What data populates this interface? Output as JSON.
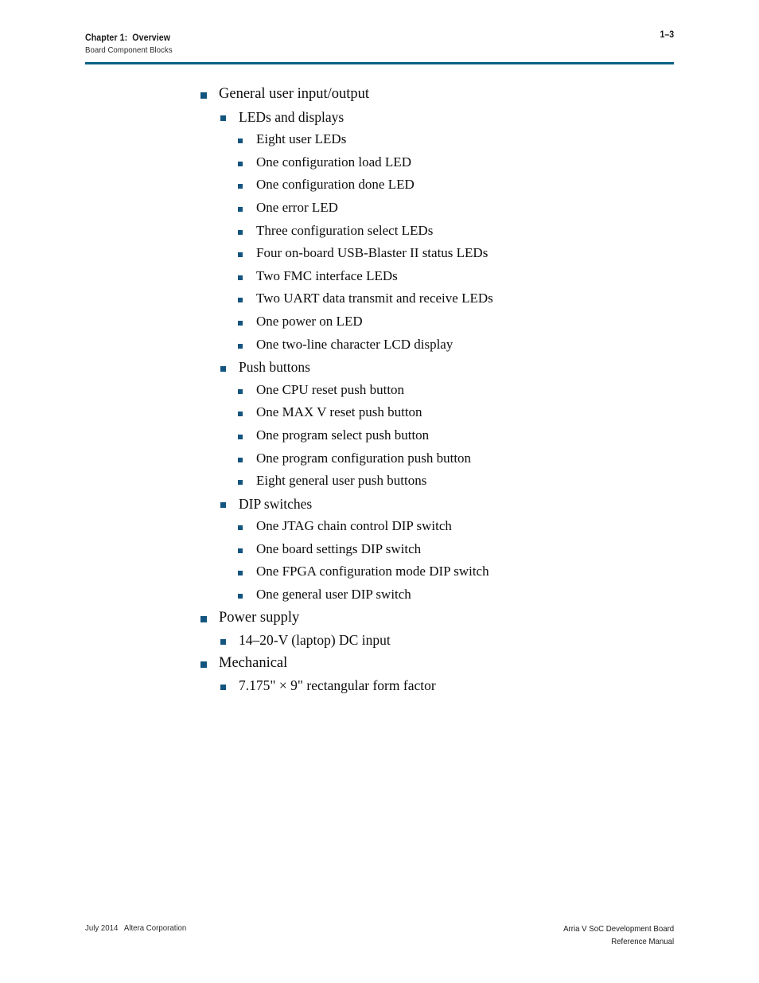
{
  "header": {
    "chapter": "Chapter 1:  Overview",
    "subtitle": "Board Component Blocks",
    "page_number": "1–3",
    "rule_color": "#0a6185"
  },
  "bullet_color": "#13557f",
  "list": [
    {
      "level": 1,
      "text": "General user input/output"
    },
    {
      "level": 2,
      "text": "LEDs and displays"
    },
    {
      "level": 3,
      "text": "Eight user LEDs"
    },
    {
      "level": 3,
      "text": "One configuration load LED"
    },
    {
      "level": 3,
      "text": "One configuration done LED"
    },
    {
      "level": 3,
      "text": "One error LED"
    },
    {
      "level": 3,
      "text": "Three configuration select LEDs"
    },
    {
      "level": 3,
      "text": "Four on-board USB-Blaster II status LEDs"
    },
    {
      "level": 3,
      "text": "Two FMC interface LEDs"
    },
    {
      "level": 3,
      "text": "Two UART data transmit and receive LEDs"
    },
    {
      "level": 3,
      "text": "One power on LED"
    },
    {
      "level": 3,
      "text": "One two-line character LCD display"
    },
    {
      "level": 2,
      "text": "Push buttons"
    },
    {
      "level": 3,
      "text": "One CPU reset push button"
    },
    {
      "level": 3,
      "text": "One MAX V reset push button"
    },
    {
      "level": 3,
      "text": "One program select push button"
    },
    {
      "level": 3,
      "text": "One program configuration push button"
    },
    {
      "level": 3,
      "text": "Eight general user push buttons"
    },
    {
      "level": 2,
      "text": "DIP switches"
    },
    {
      "level": 3,
      "text": "One JTAG chain control DIP switch"
    },
    {
      "level": 3,
      "text": "One board settings DIP switch"
    },
    {
      "level": 3,
      "text": "One FPGA configuration mode DIP switch"
    },
    {
      "level": 3,
      "text": "One general user DIP switch"
    },
    {
      "level": 1,
      "text": "Power supply"
    },
    {
      "level": 2,
      "text": "14–20-V (laptop) DC input"
    },
    {
      "level": 1,
      "text": "Mechanical"
    },
    {
      "level": 2,
      "text": "7.175\" × 9\" rectangular form factor"
    }
  ],
  "footer": {
    "left": "July 2014   Altera Corporation",
    "right_line1": "Arria V SoC Development Board",
    "right_line2": "Reference Manual"
  }
}
